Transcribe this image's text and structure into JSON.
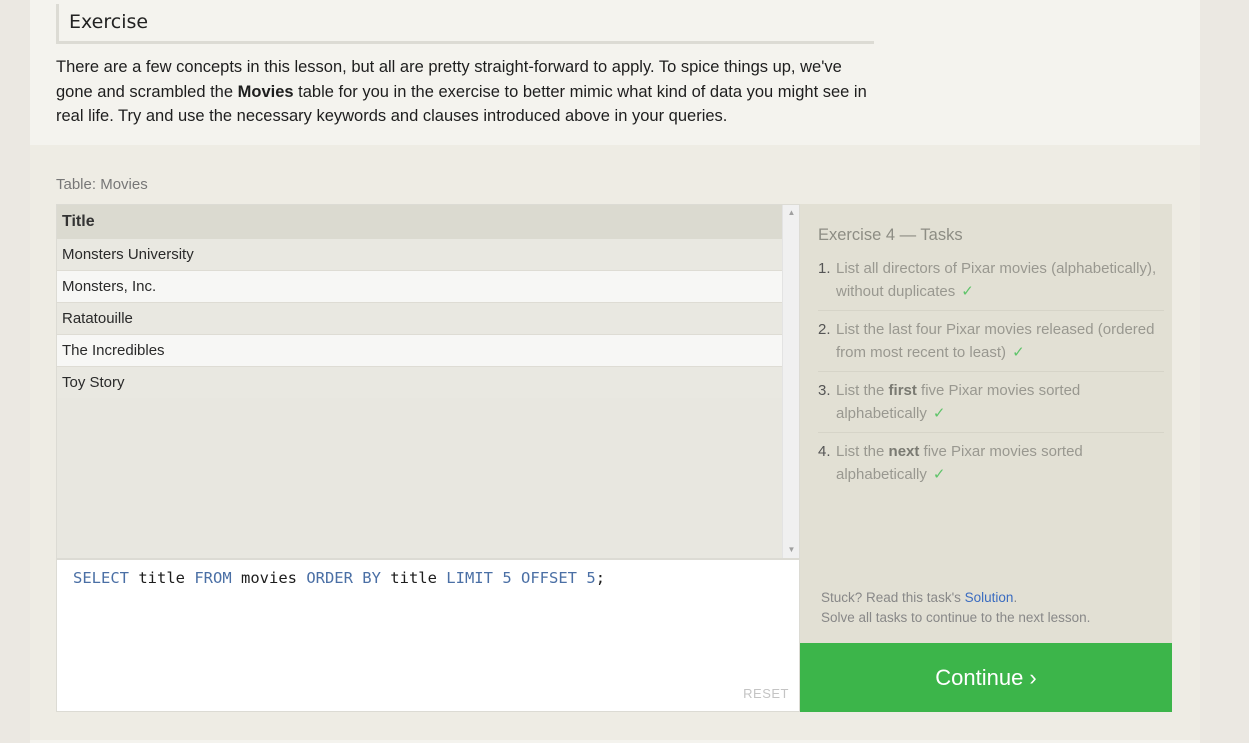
{
  "exercise_heading": "Exercise",
  "intro": {
    "part1": "There are a few concepts in this lesson, but all are pretty straight-forward to apply. To spice things up, we've gone and scrambled the ",
    "bold": "Movies",
    "part2": " table for you in the exercise to better mimic what kind of data you might see in real life. Try and use the necessary keywords and clauses introduced above in your queries."
  },
  "table_caption": "Table: Movies",
  "results": {
    "header": "Title",
    "rows": [
      "Monsters University",
      "Monsters, Inc.",
      "Ratatouille",
      "The Incredibles",
      "Toy Story"
    ]
  },
  "editor": {
    "tokens": [
      {
        "t": "SELECT",
        "k": "kw"
      },
      {
        "t": " title ",
        "k": ""
      },
      {
        "t": "FROM",
        "k": "kw"
      },
      {
        "t": " movies ",
        "k": ""
      },
      {
        "t": "ORDER BY",
        "k": "kw"
      },
      {
        "t": " title ",
        "k": ""
      },
      {
        "t": "LIMIT",
        "k": "kw"
      },
      {
        "t": " ",
        "k": ""
      },
      {
        "t": "5",
        "k": "num"
      },
      {
        "t": " ",
        "k": ""
      },
      {
        "t": "OFFSET",
        "k": "kw"
      },
      {
        "t": " ",
        "k": ""
      },
      {
        "t": "5",
        "k": "num"
      },
      {
        "t": ";",
        "k": ""
      }
    ],
    "reset_label": "RESET"
  },
  "tasks": {
    "title": "Exercise 4 — Tasks",
    "items": [
      {
        "num": "1.",
        "pre": "List all directors of Pixar movies (alphabetically), without duplicates",
        "bold": "",
        "post": "",
        "check": "✓"
      },
      {
        "num": "2.",
        "pre": "List the last four Pixar movies released (ordered from most recent to least)",
        "bold": "",
        "post": "",
        "check": "✓"
      },
      {
        "num": "3.",
        "pre": "List the ",
        "bold": "first",
        "post": " five Pixar movies sorted alphabetically",
        "check": "✓"
      },
      {
        "num": "4.",
        "pre": "List the ",
        "bold": "next",
        "post": " five Pixar movies sorted alphabetically",
        "check": "✓"
      }
    ]
  },
  "stuck": {
    "prefix": "Stuck? Read this task's ",
    "link": "Solution",
    "suffix": ".",
    "line2": "Solve all tasks to continue to the next lesson."
  },
  "continue_label": "Continue ›",
  "colors": {
    "accent_green": "#3cb54a",
    "link_blue": "#3b6cc0",
    "keyword_blue": "#4a6fa5"
  }
}
